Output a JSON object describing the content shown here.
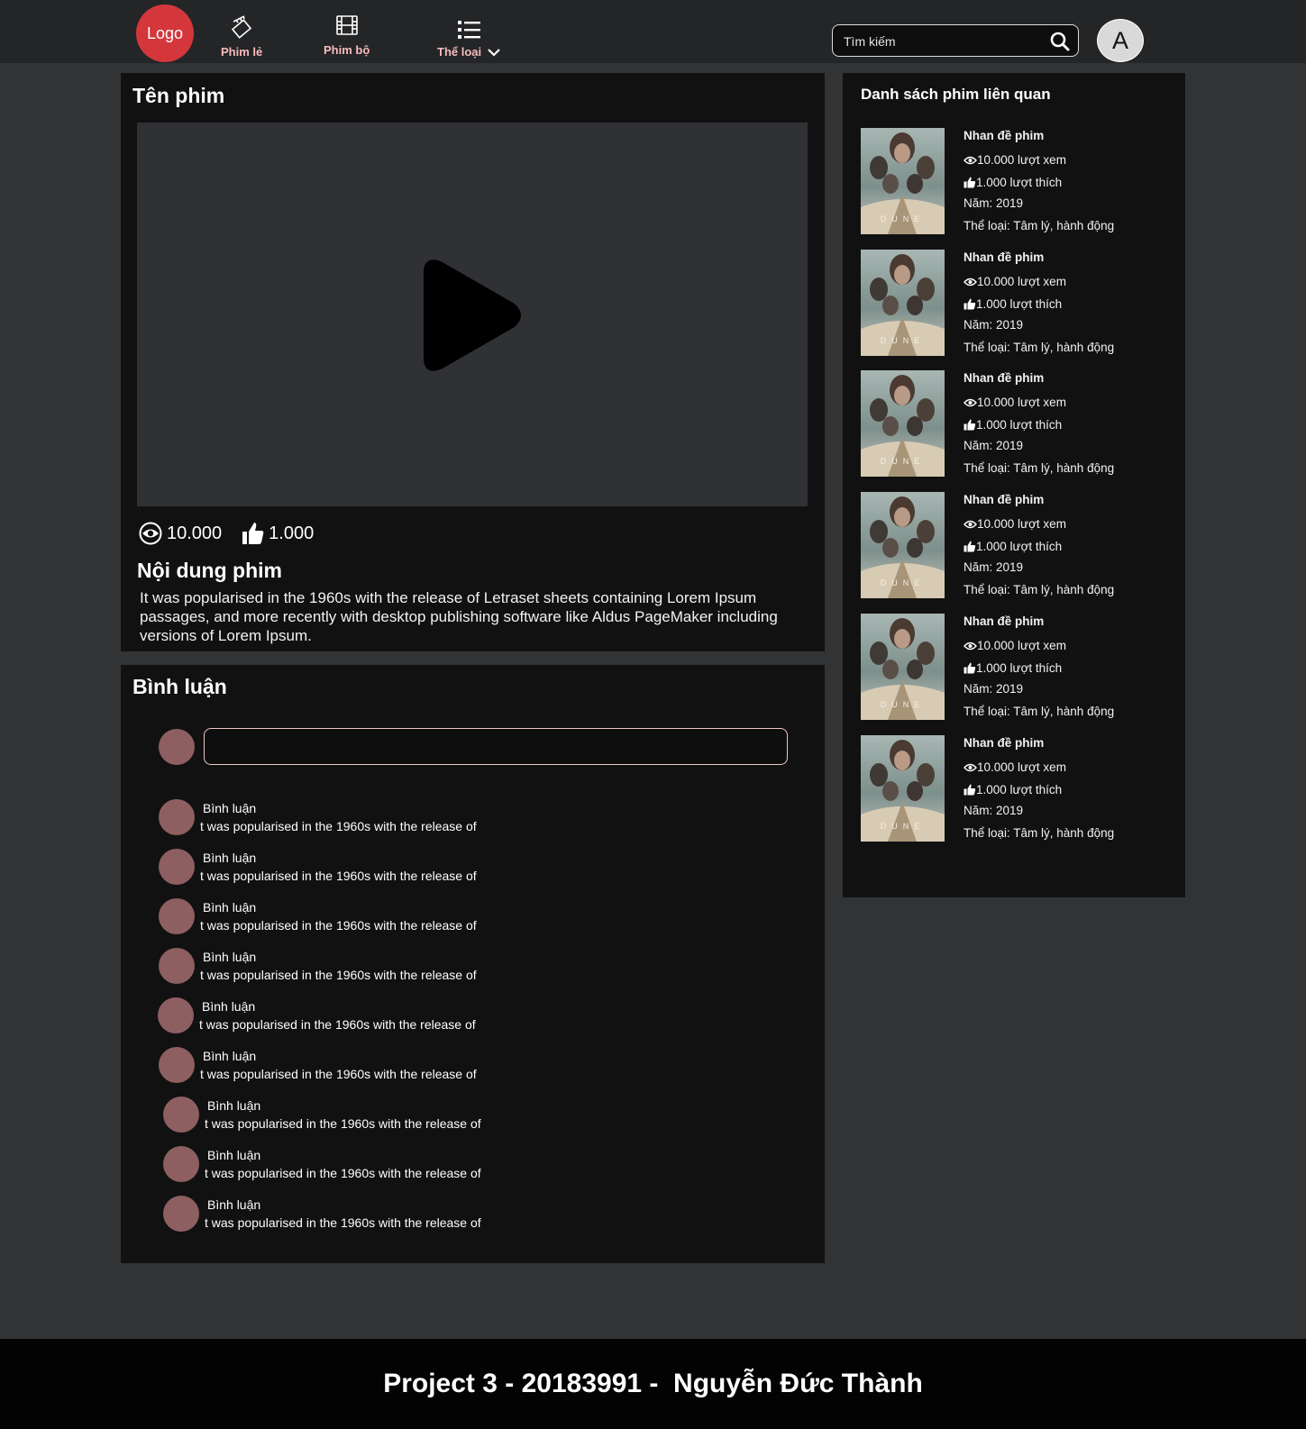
{
  "header": {
    "logo": "Logo",
    "nav": [
      {
        "label": "Phim lẻ",
        "icon": "clapperboard-icon"
      },
      {
        "label": "Phim bộ",
        "icon": "film-reel-icon"
      },
      {
        "label": "Thể  loại",
        "icon": "list-icon"
      }
    ],
    "search_placeholder": "Tìm kiếm",
    "user_initial": "A"
  },
  "movie": {
    "title": "Tên phim",
    "views": "10.000",
    "likes": "1.000",
    "content_title": "Nội dung phim",
    "content": "It was popularised in the 1960s with the release of Letraset sheets containing Lorem Ipsum passages, and more recently with desktop publishing software like Aldus PageMaker including versions of Lorem Ipsum."
  },
  "comments": {
    "heading": "Bình luận",
    "items": [
      {
        "name": "Bình luận",
        "text": "t was popularised in the 1960s with the release of"
      },
      {
        "name": "Bình luận",
        "text": "t was popularised in the 1960s with the release of"
      },
      {
        "name": "Bình luận",
        "text": "t was popularised in the 1960s with the release of"
      },
      {
        "name": "Bình luận",
        "text": "t was popularised in the 1960s with the release of"
      },
      {
        "name": "Bình luận",
        "text": "t was popularised in the 1960s with the release of"
      },
      {
        "name": "Bình luận",
        "text": "t was popularised in the 1960s with the release of"
      },
      {
        "name": "Bình luận",
        "text": "t was popularised in the 1960s with the release of"
      },
      {
        "name": "Bình luận",
        "text": "t was popularised in the 1960s with the release of"
      },
      {
        "name": "Bình luận",
        "text": "t was popularised in the 1960s with the release of"
      }
    ]
  },
  "related": {
    "heading": "Danh sách phim liên quan",
    "items": [
      {
        "title": "Nhan đề phim",
        "views": "10.000 lượt xem",
        "likes": "1.000 lượt thích",
        "year": "Năm: 2019",
        "genre": "Thể loại: Tâm lý, hành động",
        "poster_text": "DUNE"
      },
      {
        "title": "Nhan đề phim",
        "views": "10.000 lượt xem",
        "likes": "1.000 lượt thích",
        "year": "Năm: 2019",
        "genre": "Thể loại: Tâm lý, hành động",
        "poster_text": "DUNE"
      },
      {
        "title": "Nhan đề phim",
        "views": "10.000 lượt xem",
        "likes": "1.000 lượt thích",
        "year": "Năm: 2019",
        "genre": "Thể loại: Tâm lý, hành động",
        "poster_text": "DUNE"
      },
      {
        "title": "Nhan đề phim",
        "views": "10.000 lượt xem",
        "likes": "1.000 lượt thích",
        "year": "Năm: 2019",
        "genre": "Thể loại: Tâm lý, hành động",
        "poster_text": "DUNE"
      },
      {
        "title": "Nhan đề phim",
        "views": "10.000 lượt xem",
        "likes": "1.000 lượt thích",
        "year": "Năm: 2019",
        "genre": "Thể loại: Tâm lý, hành động",
        "poster_text": "DUNE"
      },
      {
        "title": "Nhan đề phim",
        "views": "10.000 lượt xem",
        "likes": "1.000 lượt thích",
        "year": "Năm: 2019",
        "genre": "Thể loại: Tâm lý, hành động",
        "poster_text": "DUNE"
      }
    ]
  },
  "footer": {
    "text": "Project 3 - 20183991 -  Nguyễn Đức Thành"
  },
  "colors": {
    "background": "#323335",
    "header": "#242527",
    "panel": "#111112",
    "logo": "#d3373b",
    "nav_label": "#f7bcbc",
    "comment_avatar": "#8e5f61",
    "footer": "#030303"
  }
}
